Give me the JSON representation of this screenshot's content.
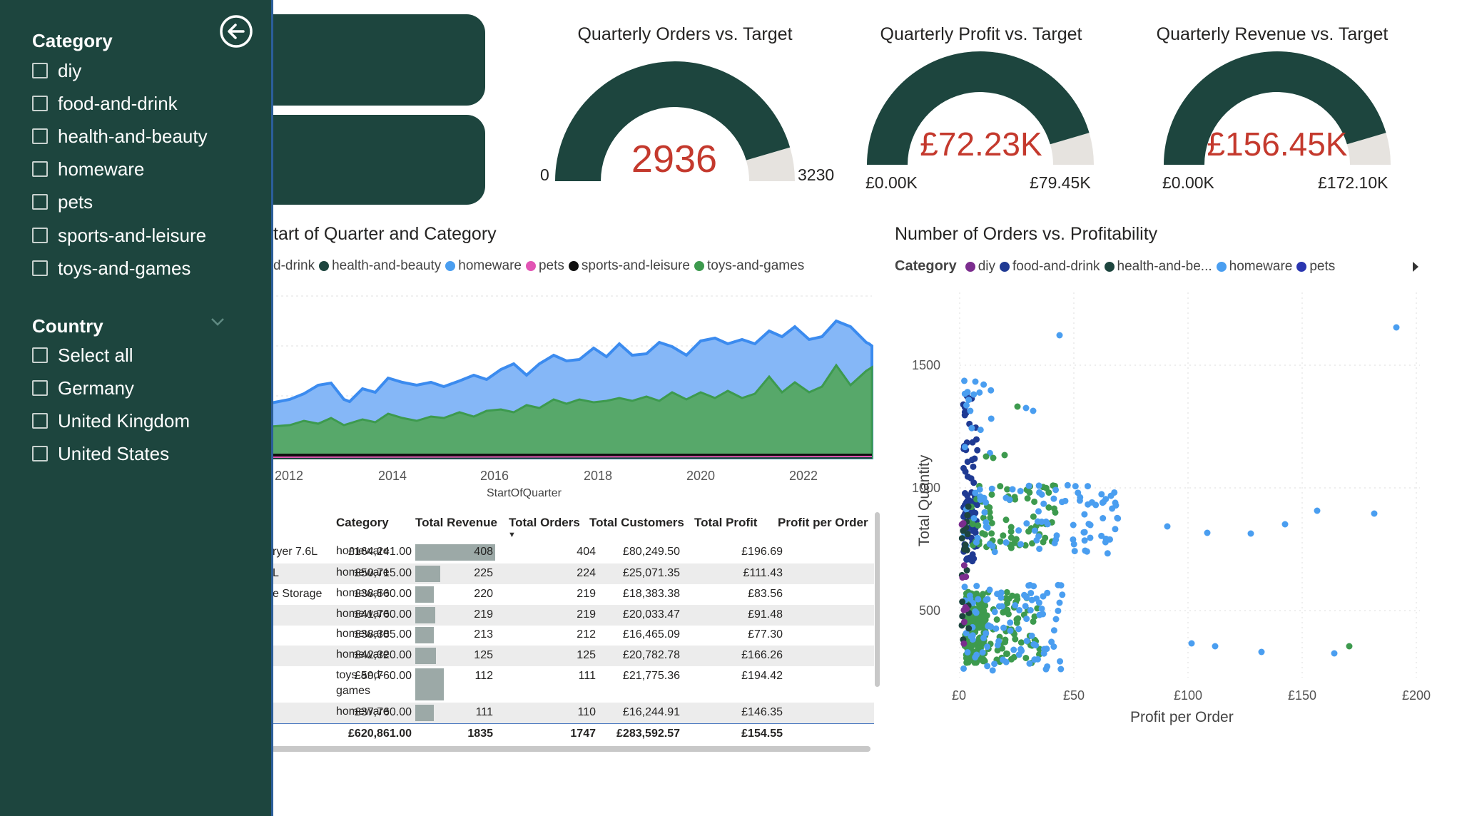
{
  "slicer_pane": {
    "category_title": "Category",
    "categories": [
      "diy",
      "food-and-drink",
      "health-and-beauty",
      "homeware",
      "pets",
      "sports-and-leisure",
      "toys-and-games"
    ],
    "country_title": "Country",
    "countries": [
      "Select all",
      "Germany",
      "United Kingdom",
      "United States"
    ],
    "back_icon": "back-arrow-icon",
    "chevron_icon": "chevron-down-icon"
  },
  "gauges": [
    {
      "title": "Quarterly Orders vs. Target",
      "value": "2936",
      "min": "0",
      "max": "3230",
      "fraction": 0.909
    },
    {
      "title": "Quarterly Profit vs. Target",
      "value": "£72.23K",
      "min": "£0.00K",
      "max": "£79.45K",
      "fraction": 0.909
    },
    {
      "title": "Quarterly Revenue vs. Target",
      "value": "£156.45K",
      "min": "£0.00K",
      "max": "£172.10K",
      "fraction": 0.909
    }
  ],
  "colors": {
    "dark_green": "#1d453e",
    "gauge_remainder": "#e6e3df",
    "value_red": "#c4392d",
    "diy": "#7b2d8e",
    "food_and_drink": "#1f3a93",
    "health_and_beauty": "#1d453e",
    "homeware": "#4a9ef0",
    "pets": "#e255b4",
    "sports_and_leisure": "#111111",
    "toys_and_games": "#3d9a4e"
  },
  "area_chart": {
    "title": "tart of Quarter and Category",
    "legend": [
      {
        "label": "d-drink",
        "color": "#1f3a93"
      },
      {
        "label": "health-and-beauty",
        "color": "#1d453e"
      },
      {
        "label": "homeware",
        "color": "#4a9ef0"
      },
      {
        "label": "pets",
        "color": "#e255b4"
      },
      {
        "label": "sports-and-leisure",
        "color": "#111111"
      },
      {
        "label": "toys-and-games",
        "color": "#3d9a4e"
      }
    ],
    "x_ticks": [
      "2012",
      "2014",
      "2016",
      "2018",
      "2020",
      "2022"
    ],
    "x_label": "StartOfQuarter"
  },
  "scatter": {
    "title": "Number of Orders vs. Profitability",
    "legend_label": "Category",
    "legend": [
      {
        "label": "diy",
        "color": "#7b2d8e"
      },
      {
        "label": "food-and-drink",
        "color": "#1f3a93"
      },
      {
        "label": "health-and-be...",
        "color": "#1d453e"
      },
      {
        "label": "homeware",
        "color": "#4a9ef0"
      },
      {
        "label": "pets",
        "color": "#2a36b0"
      }
    ],
    "y_label": "Total Quantity",
    "x_label": "Profit per Order",
    "y_ticks": [
      "1500",
      "1000",
      "500"
    ],
    "x_ticks": [
      "£0",
      "£50",
      "£100",
      "£150",
      "£200"
    ]
  },
  "table": {
    "headers": [
      "Category",
      "Total Revenue",
      "Total Orders",
      "Total Customers",
      "Total Profit",
      "Profit per Order"
    ],
    "rows": [
      {
        "product": "ryer 7.6L",
        "category": "homeware",
        "revenue": "£164,241.00",
        "orders": "408",
        "customers": "404",
        "profit": "£80,249.50",
        "ppo": "£196.69",
        "share": 1.0
      },
      {
        "product": "L",
        "category": "homeware",
        "revenue": "£50,715.00",
        "orders": "225",
        "customers": "224",
        "profit": "£25,071.35",
        "ppo": "£111.43",
        "share": 0.31
      },
      {
        "product": "e Storage",
        "category": "homeware",
        "revenue": "£38,560.00",
        "orders": "220",
        "customers": "219",
        "profit": "£18,383.38",
        "ppo": "£83.56",
        "share": 0.23
      },
      {
        "product": "",
        "category": "homeware",
        "revenue": "£41,760.00",
        "orders": "219",
        "customers": "219",
        "profit": "£20,033.47",
        "ppo": "£91.48",
        "share": 0.25
      },
      {
        "product": "",
        "category": "homeware",
        "revenue": "£38,385.00",
        "orders": "213",
        "customers": "212",
        "profit": "£16,465.09",
        "ppo": "£77.30",
        "share": 0.23
      },
      {
        "product": "",
        "category": "homeware",
        "revenue": "£42,320.00",
        "orders": "125",
        "customers": "125",
        "profit": "£20,782.78",
        "ppo": "£166.26",
        "share": 0.26
      },
      {
        "product": "",
        "category": "toys-and-games",
        "revenue": "£59,760.00",
        "orders": "112",
        "customers": "111",
        "profit": "£21,775.36",
        "ppo": "£194.42",
        "share": 0.36
      },
      {
        "product": "",
        "category": "homeware",
        "revenue": "£37,760.00",
        "orders": "111",
        "customers": "110",
        "profit": "£16,244.91",
        "ppo": "£146.35",
        "share": 0.23
      }
    ],
    "totals": {
      "revenue": "£620,861.00",
      "orders": "1835",
      "customers": "1747",
      "profit": "£283,592.57",
      "ppo": "£154.55"
    }
  }
}
